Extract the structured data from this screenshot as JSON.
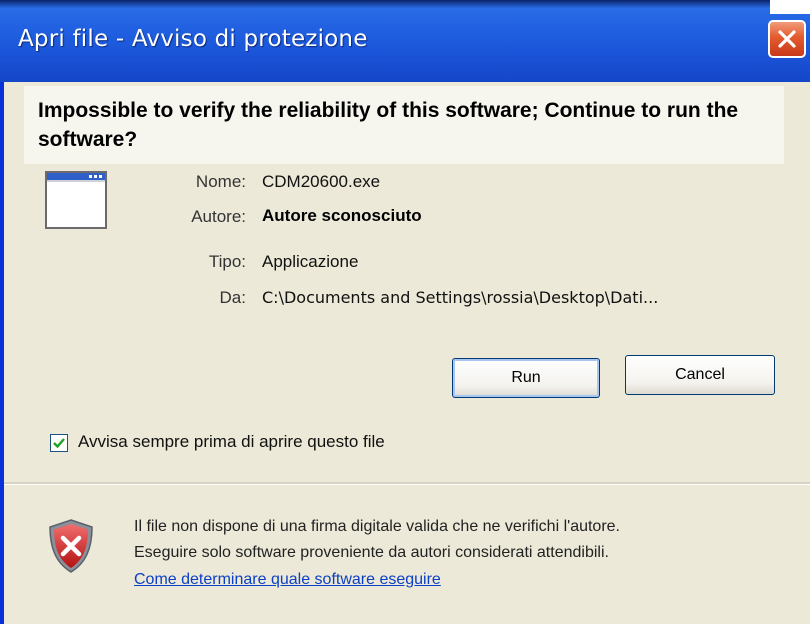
{
  "window": {
    "title": "Apri file - Avviso di protezione"
  },
  "question": "Impossible to verify the reliability of this software; Continue to run the software?",
  "file_info": [
    {
      "label": "Nome:",
      "value": "CDM20600.exe",
      "bold": false
    },
    {
      "label": "Autore:",
      "value": "Autore sconosciuto",
      "bold": true
    },
    {
      "label": "Tipo:",
      "value": "Applicazione",
      "bold": false
    },
    {
      "label": "Da:",
      "value": "C:\\Documents and Settings\\rossia\\Desktop\\Dati...",
      "bold": false
    }
  ],
  "buttons": {
    "run": "Run",
    "cancel": "Cancel"
  },
  "always_warn": {
    "label": "Avvisa sempre prima di aprire questo file",
    "checked": true
  },
  "warning": {
    "line1": "Il file non dispone di una firma digitale valida che ne verifichi l'autore.",
    "line2": "Eseguire solo software proveniente da autori considerati attendibili.",
    "link": "Come determinare quale software eseguire"
  },
  "icons": {
    "close": "close-icon",
    "file": "application-window-icon",
    "shield": "security-shield-icon",
    "check": "checkmark-icon"
  },
  "colors": {
    "title_bar": "#1f5fe0",
    "close_button": "#e35b2e",
    "dialog_background": "#ece9d8",
    "link": "#0b3fc5"
  }
}
